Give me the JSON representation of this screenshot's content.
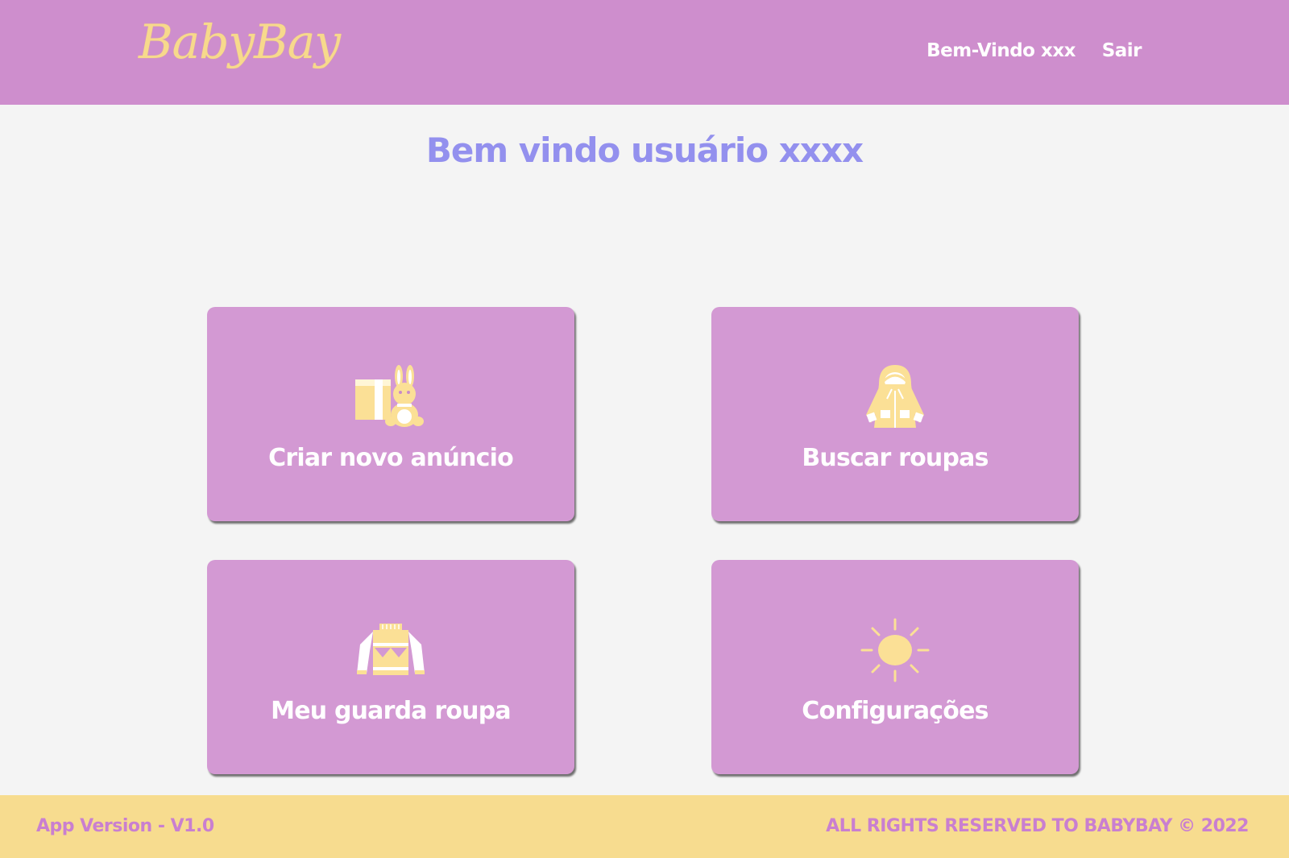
{
  "header": {
    "logo_text": "BabyBay",
    "nav": {
      "welcome_label": "Bem-Vindo xxx",
      "logout_label": "Sair"
    }
  },
  "main": {
    "title": "Bem vindo usuário xxxx",
    "cards": [
      {
        "label": "Criar novo anúncio",
        "icon": "toy-gift-icon"
      },
      {
        "label": "Buscar roupas",
        "icon": "raincoat-icon"
      },
      {
        "label": "Meu guarda roupa",
        "icon": "sweater-icon"
      },
      {
        "label": "Configurações",
        "icon": "sun-icon"
      }
    ]
  },
  "footer": {
    "version": "App Version - V1.0",
    "rights": "ALL RIGHTS RESERVED TO BABYBAY © 2022"
  },
  "colors": {
    "header_bg": "#ce8ecd",
    "card_bg": "#d399d3",
    "title": "#9390ee",
    "footer_bg": "#f7dc8f",
    "icon_yellow": "#fbe096"
  }
}
